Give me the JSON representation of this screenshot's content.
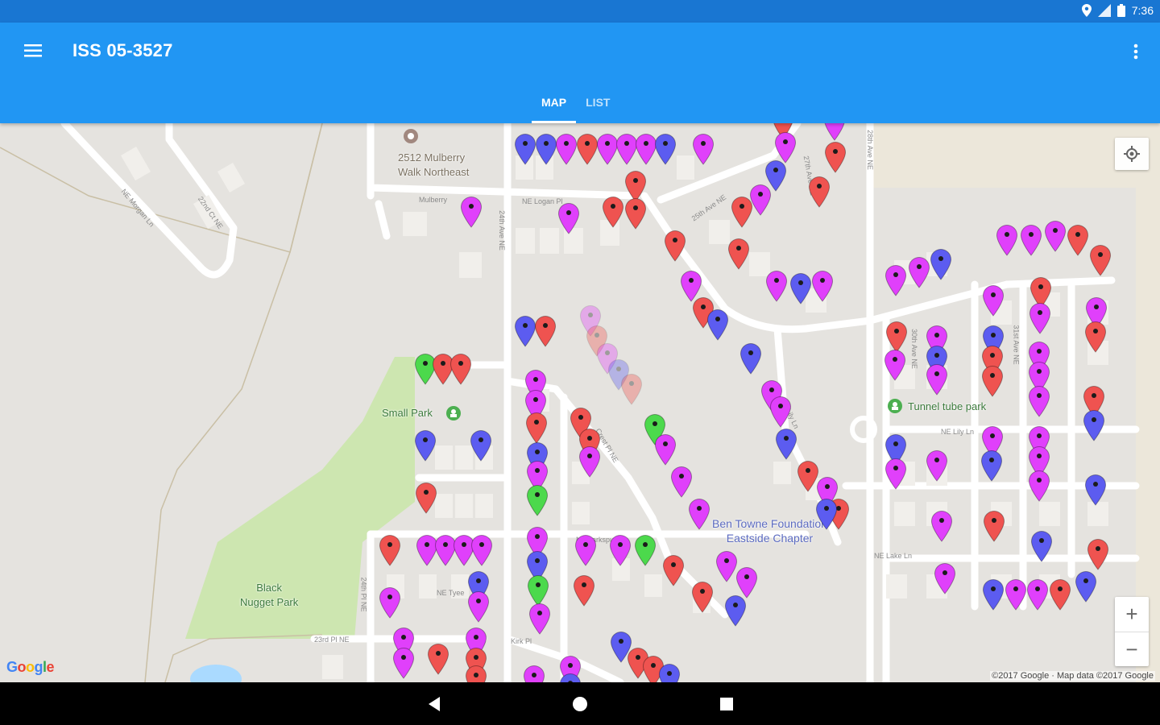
{
  "status_bar": {
    "time": "7:36"
  },
  "app_bar": {
    "title": "ISS 05-3527"
  },
  "tabs": [
    {
      "label": "MAP",
      "active": true
    },
    {
      "label": "LIST",
      "active": false
    }
  ],
  "map": {
    "labels": {
      "poi_address": "2512 Mulberry\nWalk Northeast",
      "small_park": "Small Park",
      "black_nugget": "Black\nNugget Park",
      "tunnel_park": "Tunnel tube park",
      "foundation": "Ben Towne Foundation\nEastside Chapter"
    },
    "streets": {
      "ne_morgan": "NE Morgan Ln",
      "nd_st": "22nd Ct NE",
      "mulberry": "Mulberry",
      "logan": "NE Logan Pl",
      "ave_24th": "24th Ave NE",
      "ave_25th": "25th Ave NE",
      "ave_27th": "27th Ave NE",
      "ave_28th": "28th Ave NE",
      "lily": "NE Lily Ln",
      "larkspur": "NE Larkspur Ln",
      "pl_24th": "24th Pl NE",
      "lake_ln": "NE Lake Ln",
      "kirk": "Kirk Pl",
      "crest": "Crest Pl NE",
      "n_23rd": "23rd Pl NE",
      "tyee": "NE Tyee",
      "ave_30th": "30th Ave NE",
      "ave_31st": "31st Ave NE"
    },
    "pin_colors": {
      "red": "#ef5350",
      "magenta": "#e040fb",
      "blue": "#5c5cf0",
      "green": "#4cd94c"
    },
    "zoom_in": "+",
    "zoom_out": "−",
    "google": "Google",
    "attribution": "©2017 Google · Map data ©2017 Google"
  }
}
